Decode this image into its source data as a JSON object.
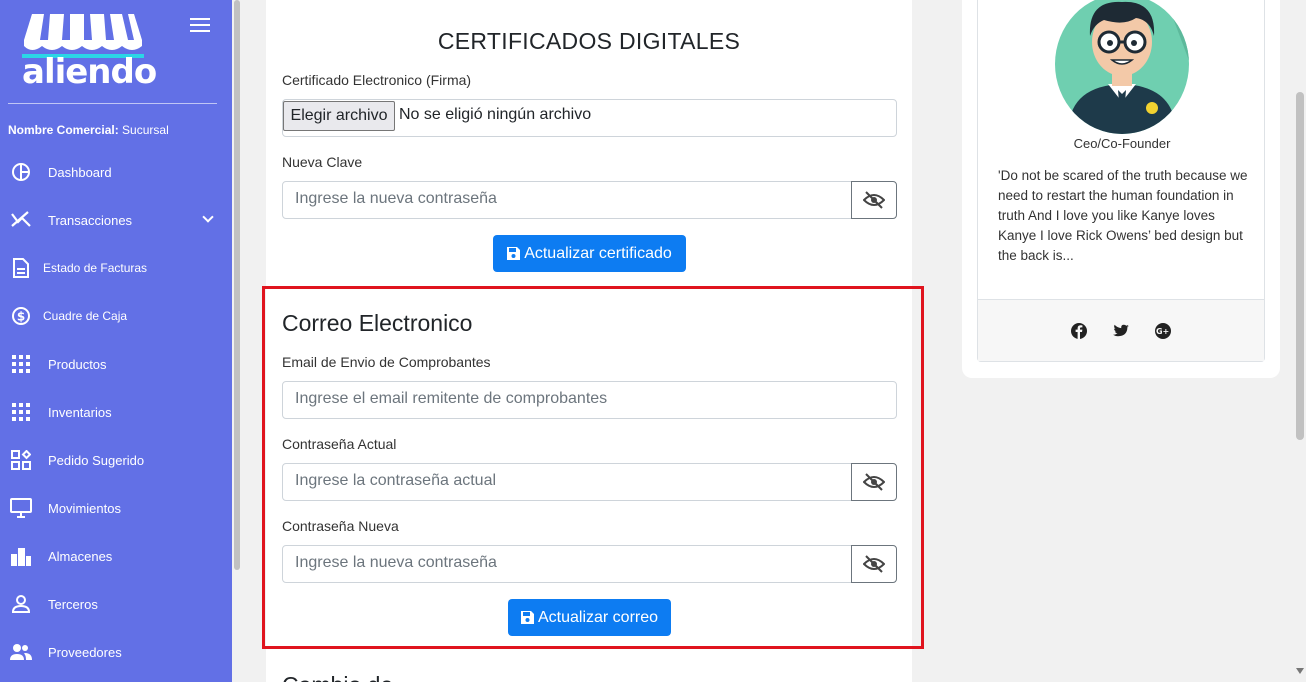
{
  "sidebar": {
    "brand": "aliendo",
    "comercial_label": "Nombre Comercial:",
    "comercial_value": "Sucursal",
    "items": [
      {
        "label": "Dashboard",
        "icon": "pie-chart-icon"
      },
      {
        "label": "Transacciones",
        "icon": "transactions-icon"
      },
      {
        "label": "Estado de Facturas",
        "icon": "invoice-icon"
      },
      {
        "label": "Cuadre de Caja",
        "icon": "dollar-icon"
      },
      {
        "label": "Productos",
        "icon": "grid-icon"
      },
      {
        "label": "Inventarios",
        "icon": "grid-icon"
      },
      {
        "label": "Pedido Sugerido",
        "icon": "widgets-icon"
      },
      {
        "label": "Movimientos",
        "icon": "monitor-icon"
      },
      {
        "label": "Almacenes",
        "icon": "building-icon"
      },
      {
        "label": "Terceros",
        "icon": "person-icon"
      },
      {
        "label": "Proveedores",
        "icon": "people-icon"
      }
    ]
  },
  "certificados": {
    "title": "CERTIFICADOS DIGITALES",
    "file_label": "Certificado Electronico (Firma)",
    "file_button": "Elegir archivo",
    "file_status": "No se eligió ningún archivo",
    "clave_label": "Nueva Clave",
    "clave_placeholder": "Ingrese la nueva contraseña",
    "submit": "Actualizar certificado"
  },
  "correo": {
    "title": "Correo Electronico",
    "email_label": "Email de Envio de Comprobantes",
    "email_placeholder": "Ingrese el email remitente de comprobantes",
    "actual_label": "Contraseña Actual",
    "actual_placeholder": "Ingrese la contraseña actual",
    "nueva_label": "Contraseña Nueva",
    "nueva_placeholder": "Ingrese la nueva contraseña",
    "submit": "Actualizar correo"
  },
  "next_section_title": "Cambio de ...",
  "profile": {
    "role": "Ceo/Co-Founder",
    "quote": "'Do not be scared of the truth because we need to restart the human foundation in truth And I love you like Kanye loves Kanye I love Rick Owens’ bed design but the back is..."
  },
  "colors": {
    "sidebar": "#6270e6",
    "primary_button": "#0d7cf2",
    "highlight_border": "#e0141e"
  }
}
